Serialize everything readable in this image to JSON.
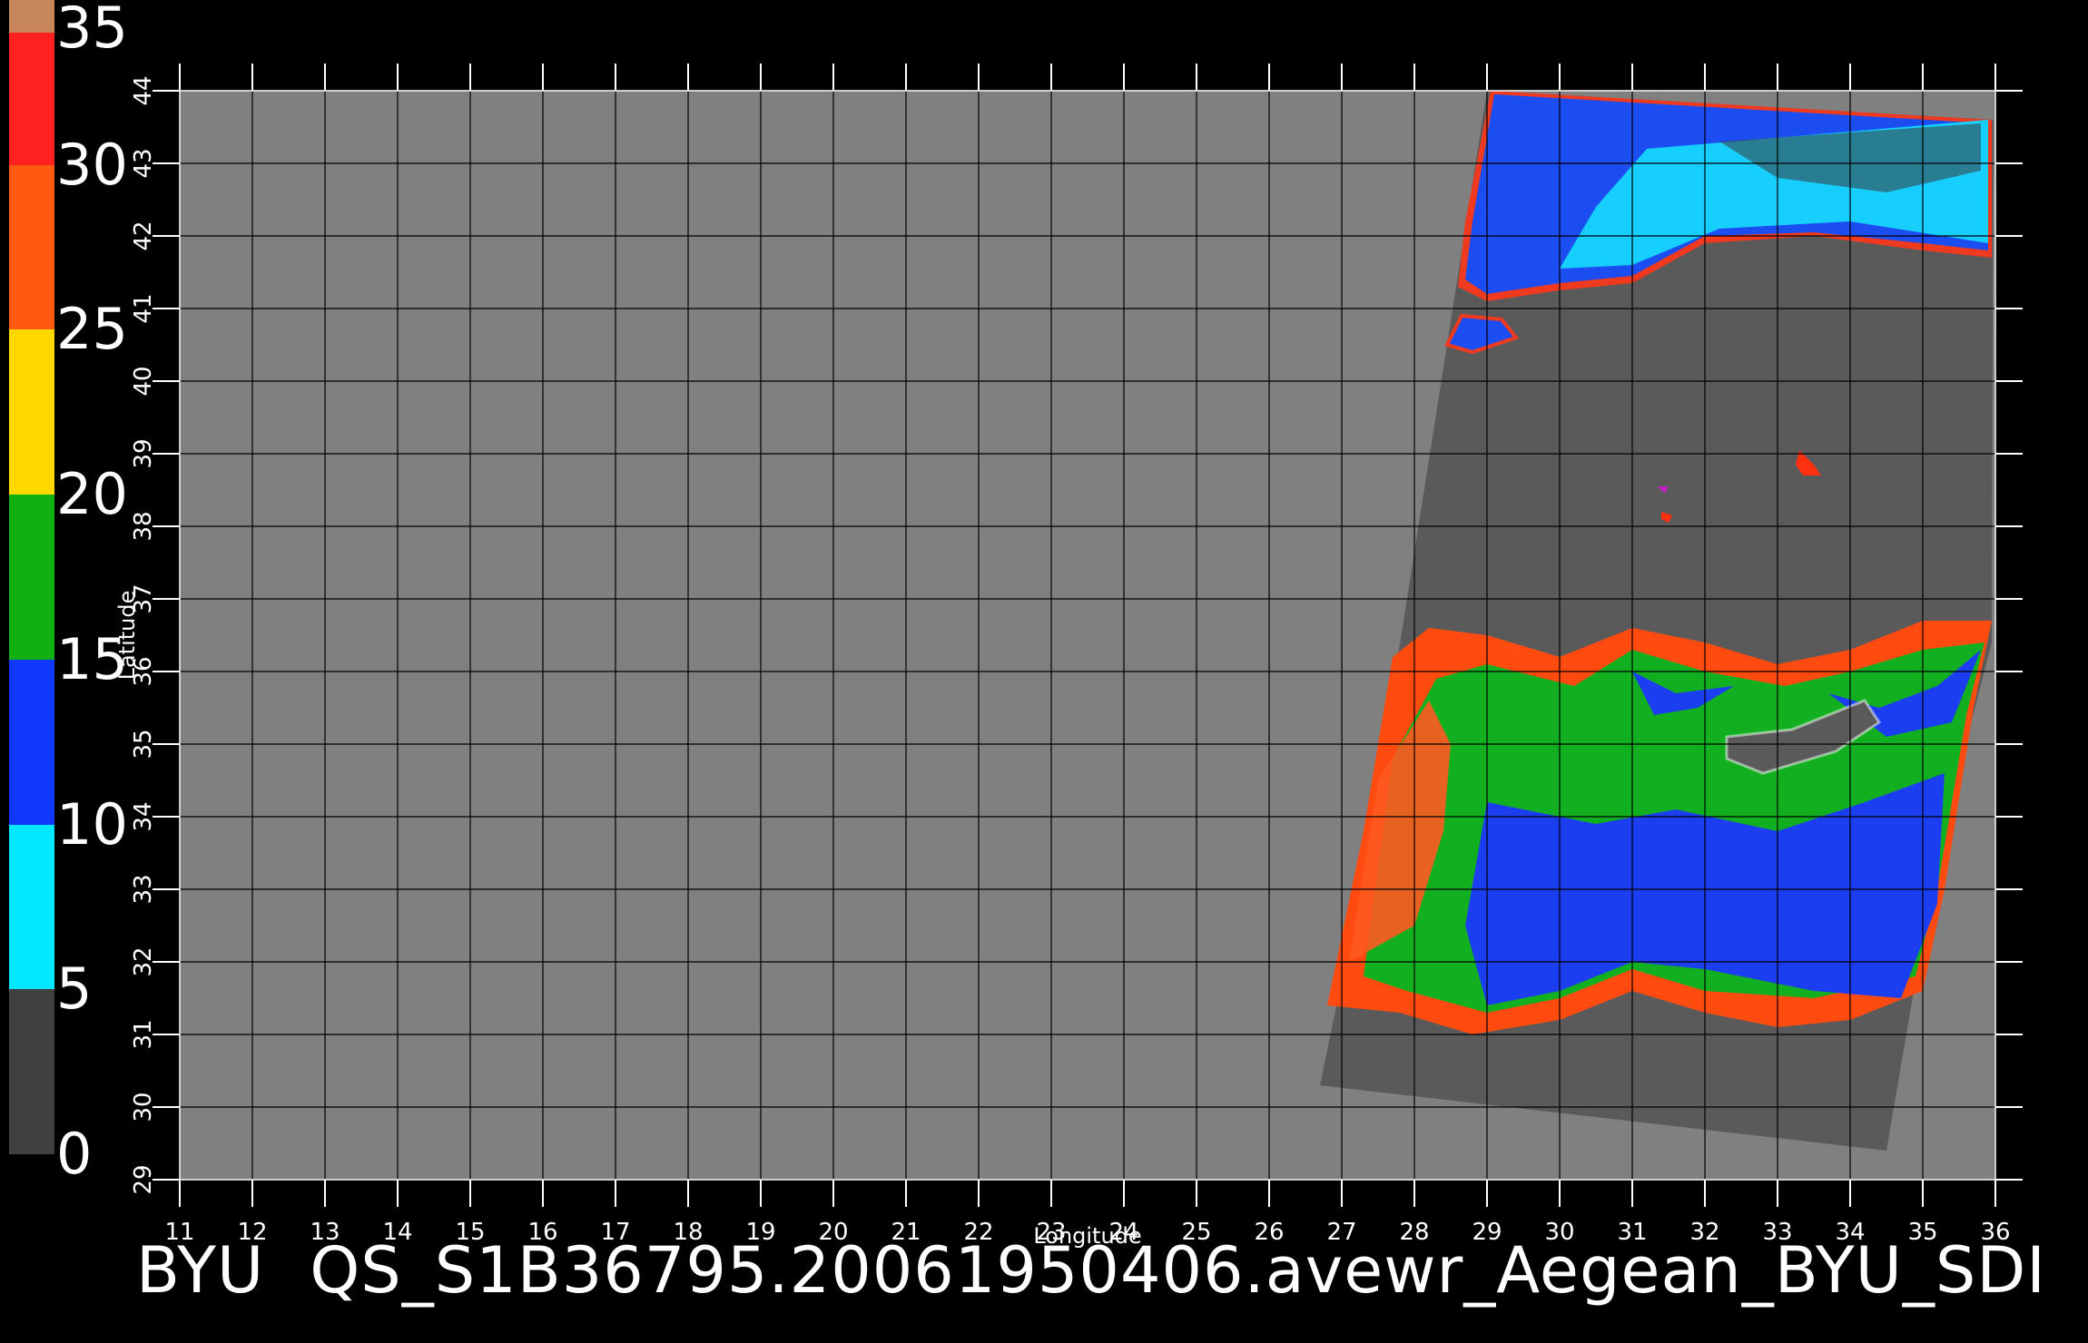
{
  "colorbar": {
    "labels": [
      "35",
      "30",
      "25",
      "20",
      "15",
      "10",
      "5",
      "0"
    ],
    "stops": [
      {
        "from": 35,
        "to": 34,
        "color": "#c8875a"
      },
      {
        "from": 34,
        "to": 30,
        "color": "#ff2020"
      },
      {
        "from": 30,
        "to": 25,
        "color": "#ff5a10"
      },
      {
        "from": 25,
        "to": 20,
        "color": "#ffd800"
      },
      {
        "from": 20,
        "to": 15,
        "color": "#10b010"
      },
      {
        "from": 15,
        "to": 10,
        "color": "#1038ff"
      },
      {
        "from": 10,
        "to": 5,
        "color": "#00e8ff"
      },
      {
        "from": 5,
        "to": 0,
        "color": "#404040"
      }
    ]
  },
  "map": {
    "lon_range": [
      11,
      36
    ],
    "lat_range": [
      29,
      44
    ],
    "lon_ticks": [
      "11",
      "12",
      "13",
      "14",
      "15",
      "16",
      "17",
      "18",
      "19",
      "20",
      "21",
      "22",
      "23",
      "24",
      "25",
      "26",
      "27",
      "28",
      "29",
      "30",
      "31",
      "32",
      "33",
      "34",
      "35",
      "36"
    ],
    "lat_ticks": [
      "29",
      "30",
      "31",
      "32",
      "33",
      "34",
      "35",
      "36",
      "37",
      "38",
      "39",
      "40",
      "41",
      "42",
      "43",
      "44"
    ],
    "xlabel": "Longitude",
    "ylabel": "Latitude",
    "background_color": "#808080",
    "swath_color": "#5a5a5a",
    "grid_color": "#000000"
  },
  "footer": {
    "left": "BYU",
    "right": "QS_S1B36795.20061950406.avewr_Aegean_BYU_SDI"
  }
}
